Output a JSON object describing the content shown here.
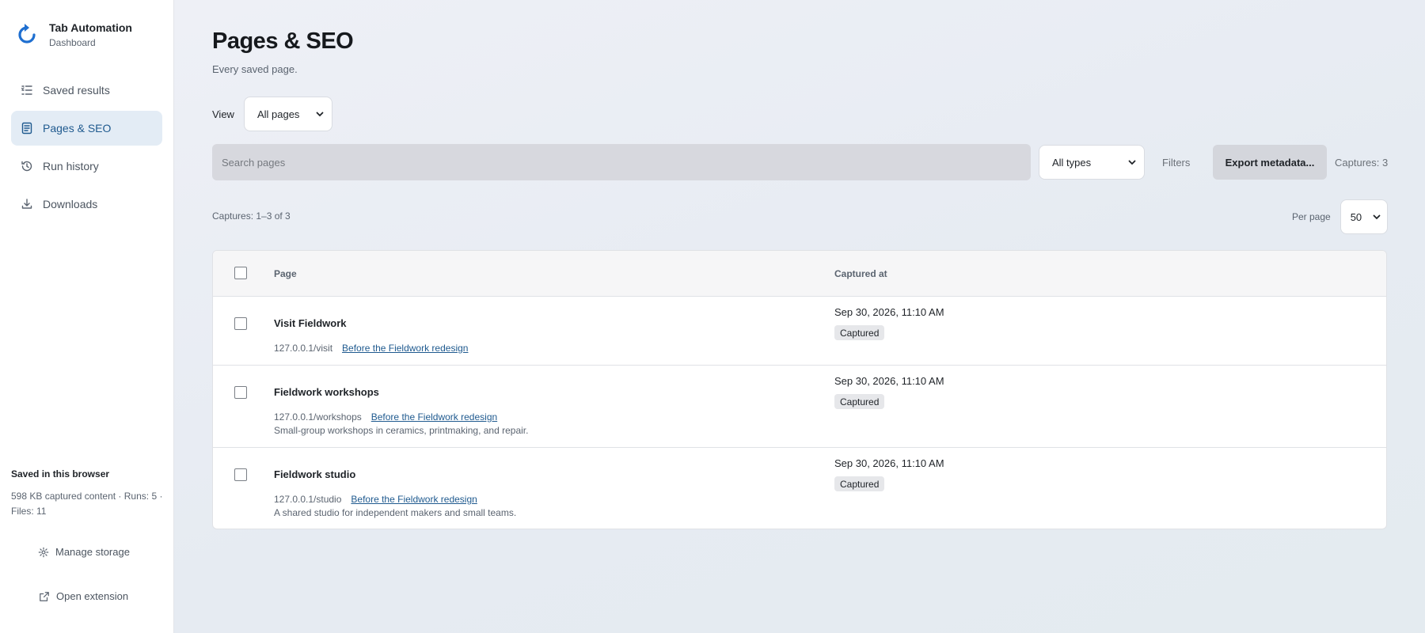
{
  "brand": {
    "title": "Tab Automation",
    "subtitle": "Dashboard",
    "accent": "#1f6fd0"
  },
  "nav": {
    "items": [
      {
        "label": "Saved results",
        "icon": "list-icon",
        "active": false
      },
      {
        "label": "Pages & SEO",
        "icon": "document-icon",
        "active": true
      },
      {
        "label": "Run history",
        "icon": "history-icon",
        "active": false
      },
      {
        "label": "Downloads",
        "icon": "download-icon",
        "active": false
      }
    ]
  },
  "storage": {
    "title": "Saved in this browser",
    "info": "598 KB captured content · Runs: 5 · Files: 11",
    "manage_label": "Manage storage",
    "open_label": "Open extension"
  },
  "page": {
    "title": "Pages & SEO",
    "subtitle": "Every saved page."
  },
  "view": {
    "label": "View",
    "selected": "All pages"
  },
  "toolbar": {
    "search_placeholder": "Search pages",
    "types_selected": "All types",
    "filters_label": "Filters",
    "export_label": "Export metadata...",
    "captures_count": "Captures: 3"
  },
  "list": {
    "range_text": "Captures: 1–3 of 3",
    "per_page_label": "Per page",
    "per_page_value": "50"
  },
  "table": {
    "columns": {
      "page": "Page",
      "captured_at": "Captured at"
    },
    "rows": [
      {
        "title": "Visit Fieldwork",
        "url": "127.0.0.1/visit",
        "link": "Before the Fieldwork redesign",
        "description": "",
        "date": "Sep 30, 2026, 11:10 AM",
        "status": "Captured"
      },
      {
        "title": "Fieldwork workshops",
        "url": "127.0.0.1/workshops",
        "link": "Before the Fieldwork redesign",
        "description": "Small-group workshops in ceramics, printmaking, and repair.",
        "date": "Sep 30, 2026, 11:10 AM",
        "status": "Captured"
      },
      {
        "title": "Fieldwork studio",
        "url": "127.0.0.1/studio",
        "link": "Before the Fieldwork redesign",
        "description": "A shared studio for independent makers and small teams.",
        "date": "Sep 30, 2026, 11:10 AM",
        "status": "Captured"
      }
    ]
  }
}
